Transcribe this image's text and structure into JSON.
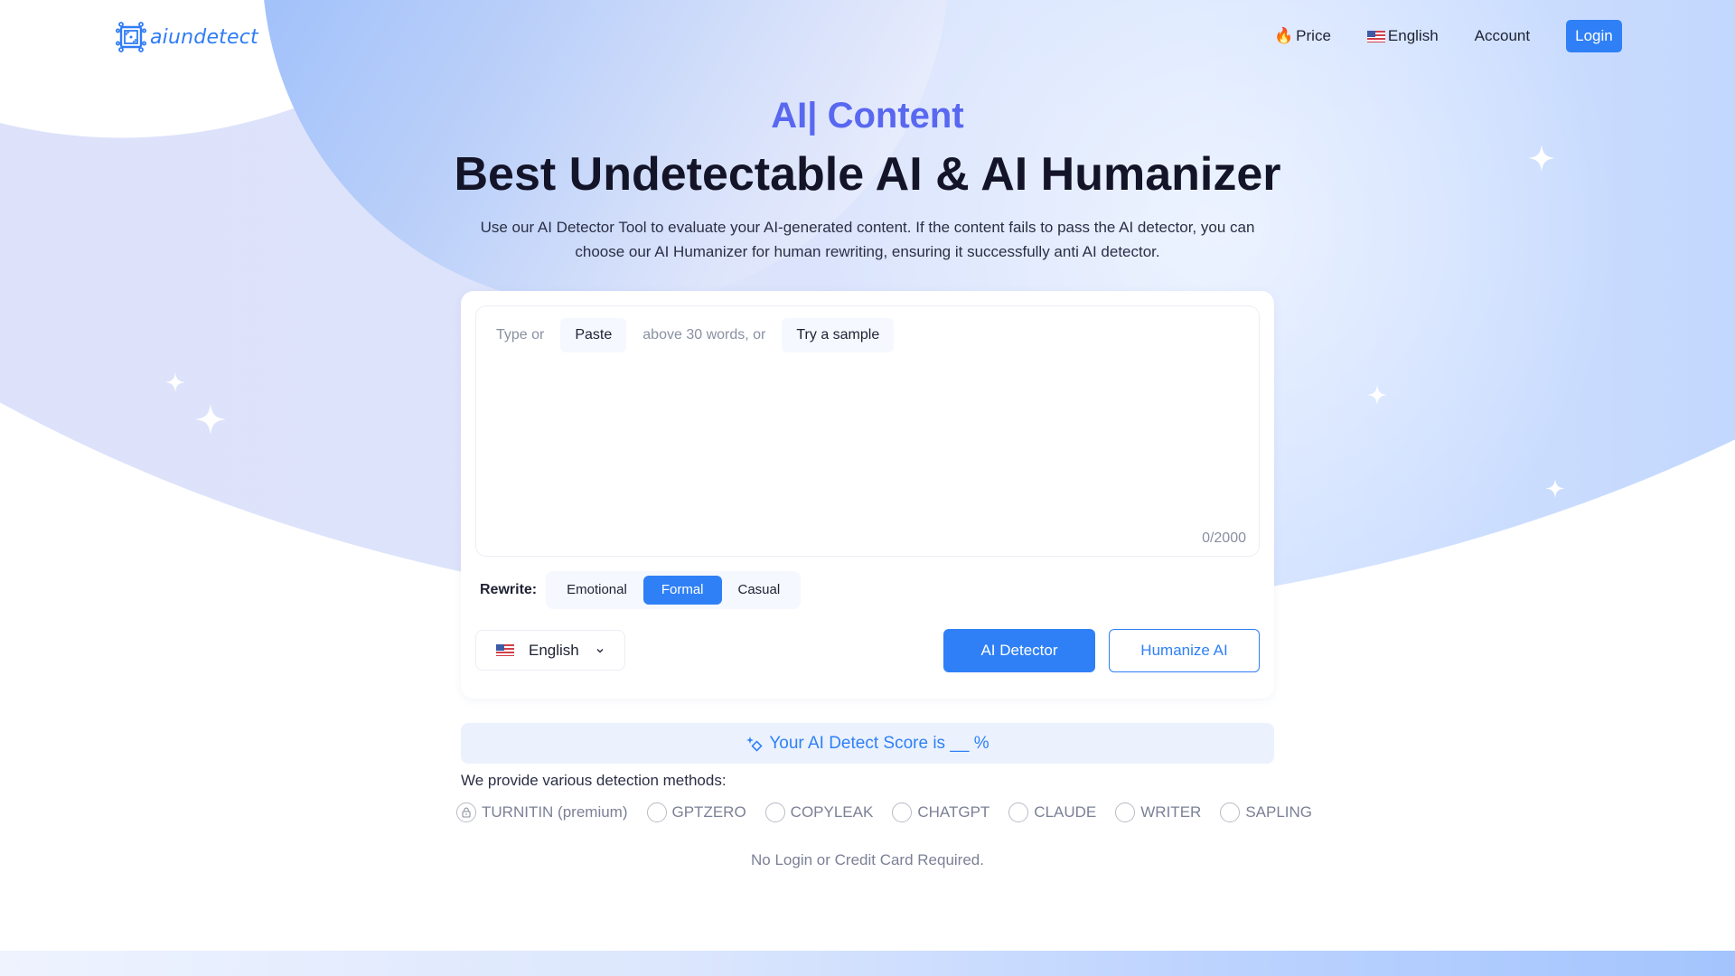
{
  "header": {
    "logo_text": "aiundetect",
    "nav": {
      "price_icon": "🔥",
      "price": "Price",
      "language": "English",
      "account": "Account",
      "login": "Login"
    }
  },
  "hero": {
    "kicker": "AI| Content",
    "title": "Best Undetectable AI & AI Humanizer",
    "subtitle": "Use our AI Detector Tool to evaluate your AI-generated content. If the content fails to pass the AI detector, you can choose our AI Humanizer for human rewriting, ensuring it successfully anti AI detector."
  },
  "editor": {
    "hint_prefix": "Type or",
    "paste_label": "Paste",
    "hint_middle": "above 30 words, or",
    "sample_label": "Try a sample",
    "value": "",
    "counter": "0/2000"
  },
  "rewrite": {
    "label": "Rewrite:",
    "options": [
      {
        "label": "Emotional",
        "active": false
      },
      {
        "label": "Formal",
        "active": true
      },
      {
        "label": "Casual",
        "active": false
      }
    ]
  },
  "language_select": {
    "value": "English"
  },
  "actions": {
    "detect": "AI Detector",
    "humanize": "Humanize AI"
  },
  "score": {
    "text": "Your AI Detect Score is __ %"
  },
  "methods": {
    "label": "We provide various detection methods:",
    "items": [
      {
        "label": "TURNITIN (premium)",
        "locked": true
      },
      {
        "label": "GPTZERO",
        "locked": false
      },
      {
        "label": "COPYLEAK",
        "locked": false
      },
      {
        "label": "CHATGPT",
        "locked": false
      },
      {
        "label": "CLAUDE",
        "locked": false
      },
      {
        "label": "WRITER",
        "locked": false
      },
      {
        "label": "SAPLING",
        "locked": false
      }
    ]
  },
  "footnote": "No Login or Credit Card Required.",
  "colors": {
    "accent": "#2f80f6",
    "kicker": "#5968f0",
    "title": "#141429",
    "score_bg": "#ebf2fe"
  }
}
